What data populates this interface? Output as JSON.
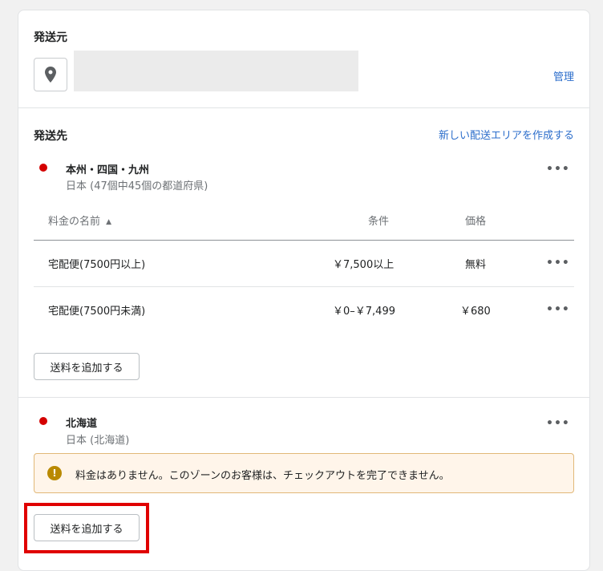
{
  "origin": {
    "title": "発送元",
    "manage_label": "管理"
  },
  "destination": {
    "title": "発送先",
    "create_zone_label": "新しい配送エリアを作成する"
  },
  "zones": [
    {
      "name": "本州・四国・九州",
      "subtitle": "日本 (47個中45個の都道府県)",
      "table": {
        "headers": {
          "name": "料金の名前",
          "sort_indicator": "▲",
          "condition": "条件",
          "price": "価格"
        },
        "rows": [
          {
            "name": "宅配便(7500円以上)",
            "condition": "￥7,500以上",
            "price": "無料"
          },
          {
            "name": "宅配便(7500円未満)",
            "condition": "￥0–￥7,499",
            "price": "￥680"
          }
        ]
      },
      "add_rate_label": "送料を追加する"
    },
    {
      "name": "北海道",
      "subtitle": "日本 (北海道)",
      "warning": "料金はありません。このゾーンのお客様は、チェックアウトを完了できません。",
      "add_rate_label": "送料を追加する"
    }
  ],
  "colors": {
    "zone_dot": "#d40000",
    "link": "#2c6ecb",
    "warning_bg": "#fff5ea",
    "warning_border": "#e1b878",
    "highlight": "#e00000"
  }
}
